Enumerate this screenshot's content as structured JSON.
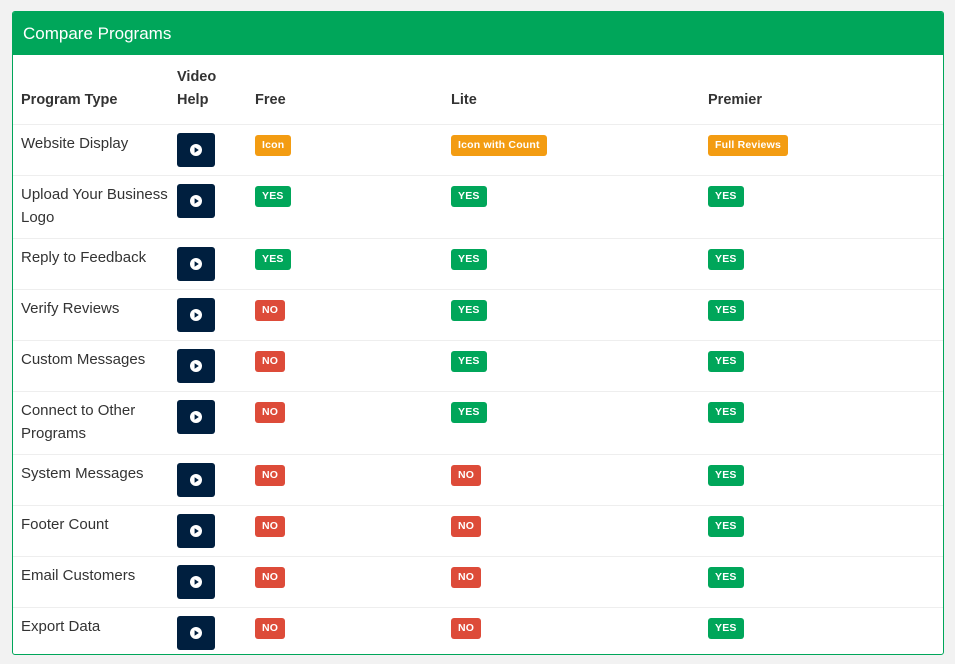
{
  "panel": {
    "title": "Compare Programs"
  },
  "columns": {
    "program_type": "Program Type",
    "video_help": "Video Help",
    "free": "Free",
    "lite": "Lite",
    "premier": "Premier"
  },
  "colors": {
    "header_green": "#00a65a",
    "yes": "#00a65a",
    "no": "#dd4b39",
    "info": "#f39c12",
    "video_button": "#001f3f"
  },
  "rows": [
    {
      "label": "Website Display",
      "free": {
        "text": "Icon",
        "type": "info"
      },
      "lite": {
        "text": "Icon with Count",
        "type": "info"
      },
      "premier": {
        "text": "Full Reviews",
        "type": "info"
      }
    },
    {
      "label": "Upload Your Business Logo",
      "free": {
        "text": "YES",
        "type": "yes"
      },
      "lite": {
        "text": "YES",
        "type": "yes"
      },
      "premier": {
        "text": "YES",
        "type": "yes"
      }
    },
    {
      "label": "Reply to Feedback",
      "free": {
        "text": "YES",
        "type": "yes"
      },
      "lite": {
        "text": "YES",
        "type": "yes"
      },
      "premier": {
        "text": "YES",
        "type": "yes"
      }
    },
    {
      "label": "Verify Reviews",
      "free": {
        "text": "NO",
        "type": "no"
      },
      "lite": {
        "text": "YES",
        "type": "yes"
      },
      "premier": {
        "text": "YES",
        "type": "yes"
      }
    },
    {
      "label": "Custom Messages",
      "free": {
        "text": "NO",
        "type": "no"
      },
      "lite": {
        "text": "YES",
        "type": "yes"
      },
      "premier": {
        "text": "YES",
        "type": "yes"
      }
    },
    {
      "label": "Connect to Other Programs",
      "free": {
        "text": "NO",
        "type": "no"
      },
      "lite": {
        "text": "YES",
        "type": "yes"
      },
      "premier": {
        "text": "YES",
        "type": "yes"
      }
    },
    {
      "label": "System Messages",
      "free": {
        "text": "NO",
        "type": "no"
      },
      "lite": {
        "text": "NO",
        "type": "no"
      },
      "premier": {
        "text": "YES",
        "type": "yes"
      }
    },
    {
      "label": "Footer Count",
      "free": {
        "text": "NO",
        "type": "no"
      },
      "lite": {
        "text": "NO",
        "type": "no"
      },
      "premier": {
        "text": "YES",
        "type": "yes"
      }
    },
    {
      "label": "Email Customers",
      "free": {
        "text": "NO",
        "type": "no"
      },
      "lite": {
        "text": "NO",
        "type": "no"
      },
      "premier": {
        "text": "YES",
        "type": "yes"
      }
    },
    {
      "label": "Export Data",
      "free": {
        "text": "NO",
        "type": "no"
      },
      "lite": {
        "text": "NO",
        "type": "no"
      },
      "premier": {
        "text": "YES",
        "type": "yes"
      }
    }
  ],
  "icons": {
    "video": "play-circle-icon"
  }
}
